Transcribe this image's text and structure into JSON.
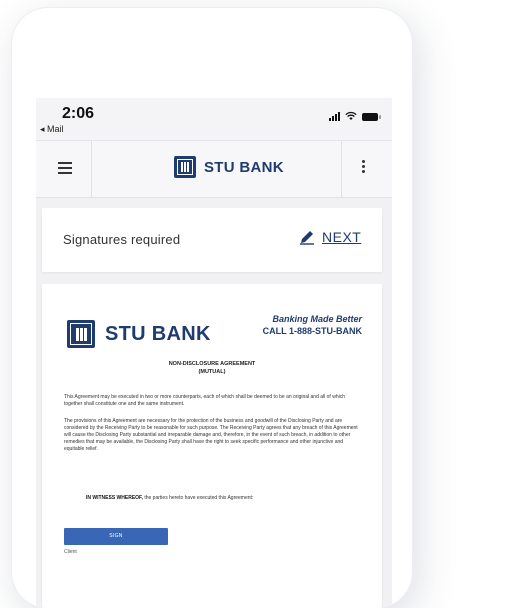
{
  "status_bar": {
    "time": "2:06",
    "back_label": "◂ Mail"
  },
  "nav": {
    "brand": "STU BANK"
  },
  "signatures_card": {
    "label": "Signatures required",
    "next_label": "NEXT"
  },
  "document": {
    "brand": "STU BANK",
    "tagline": "Banking Made Better",
    "phone": "CALL 1-888-STU-BANK",
    "title": "NON-DISCLOSURE AGREEMENT",
    "subtitle": "(MUTUAL)",
    "paragraph_1": "This Agreement may be executed in two or more counterparts, each of which shall be deemed to be an original and all of which together shall constitute one and the same instrument.",
    "paragraph_2": "The provisions of this Agreement are necessary for the protection of the business and goodwill of the Disclosing Party and are considered by the Receiving Party to be reasonable for such purpose. The Receiving Party agrees that any breach of this Agreement will cause the Disclosing Party substantial and irreparable damage and, therefore, in the event of such breach, in addition to other remedies that may be available, the Disclosing Party shall have the right to seek specific performance and other injunctive and equitable relief.",
    "witness_bold": "IN WITNESS WHEREOF,",
    "witness_rest": " the parties hereto have executed this Agreement:",
    "sign_label": "SIGN",
    "client_label": "Client"
  },
  "colors": {
    "brand": "#1f3c6e",
    "sign_button": "#3a67b5"
  }
}
